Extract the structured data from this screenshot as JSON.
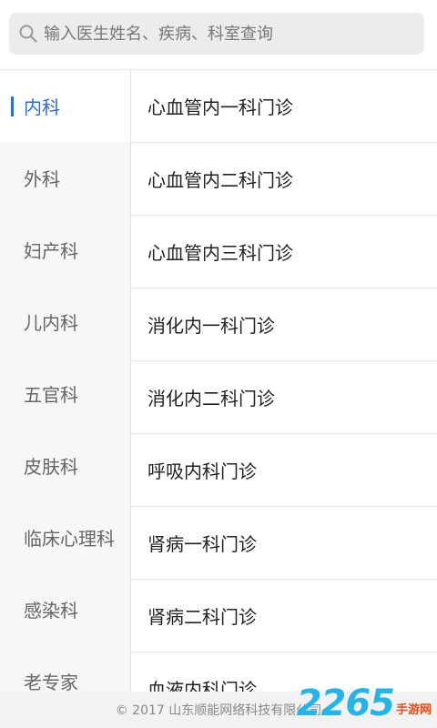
{
  "search": {
    "placeholder": "输入医生姓名、疾病、科室查询"
  },
  "sidebar": {
    "items": [
      {
        "label": "内科",
        "active": true
      },
      {
        "label": "外科"
      },
      {
        "label": "妇产科"
      },
      {
        "label": "儿内科"
      },
      {
        "label": "五官科"
      },
      {
        "label": "皮肤科"
      },
      {
        "label": "临床心理科"
      },
      {
        "label": "感染科"
      },
      {
        "label": "老专家"
      }
    ]
  },
  "clinics": [
    "心血管内一科门诊",
    "心血管内二科门诊",
    "心血管内三科门诊",
    "消化内一科门诊",
    "消化内二科门诊",
    "呼吸内科门诊",
    "肾病一科门诊",
    "肾病二科门诊",
    "血液内科门诊"
  ],
  "footer": {
    "copyright": "© 2017 山东顺能网络科技有限公司"
  },
  "watermark": {
    "number": "2265",
    "text": "手游网"
  },
  "colors": {
    "accent": "#2a6fd6",
    "sidebar_bg": "#f7f7f7",
    "search_bg": "#ececec"
  },
  "icons": {
    "search": "search-icon"
  }
}
